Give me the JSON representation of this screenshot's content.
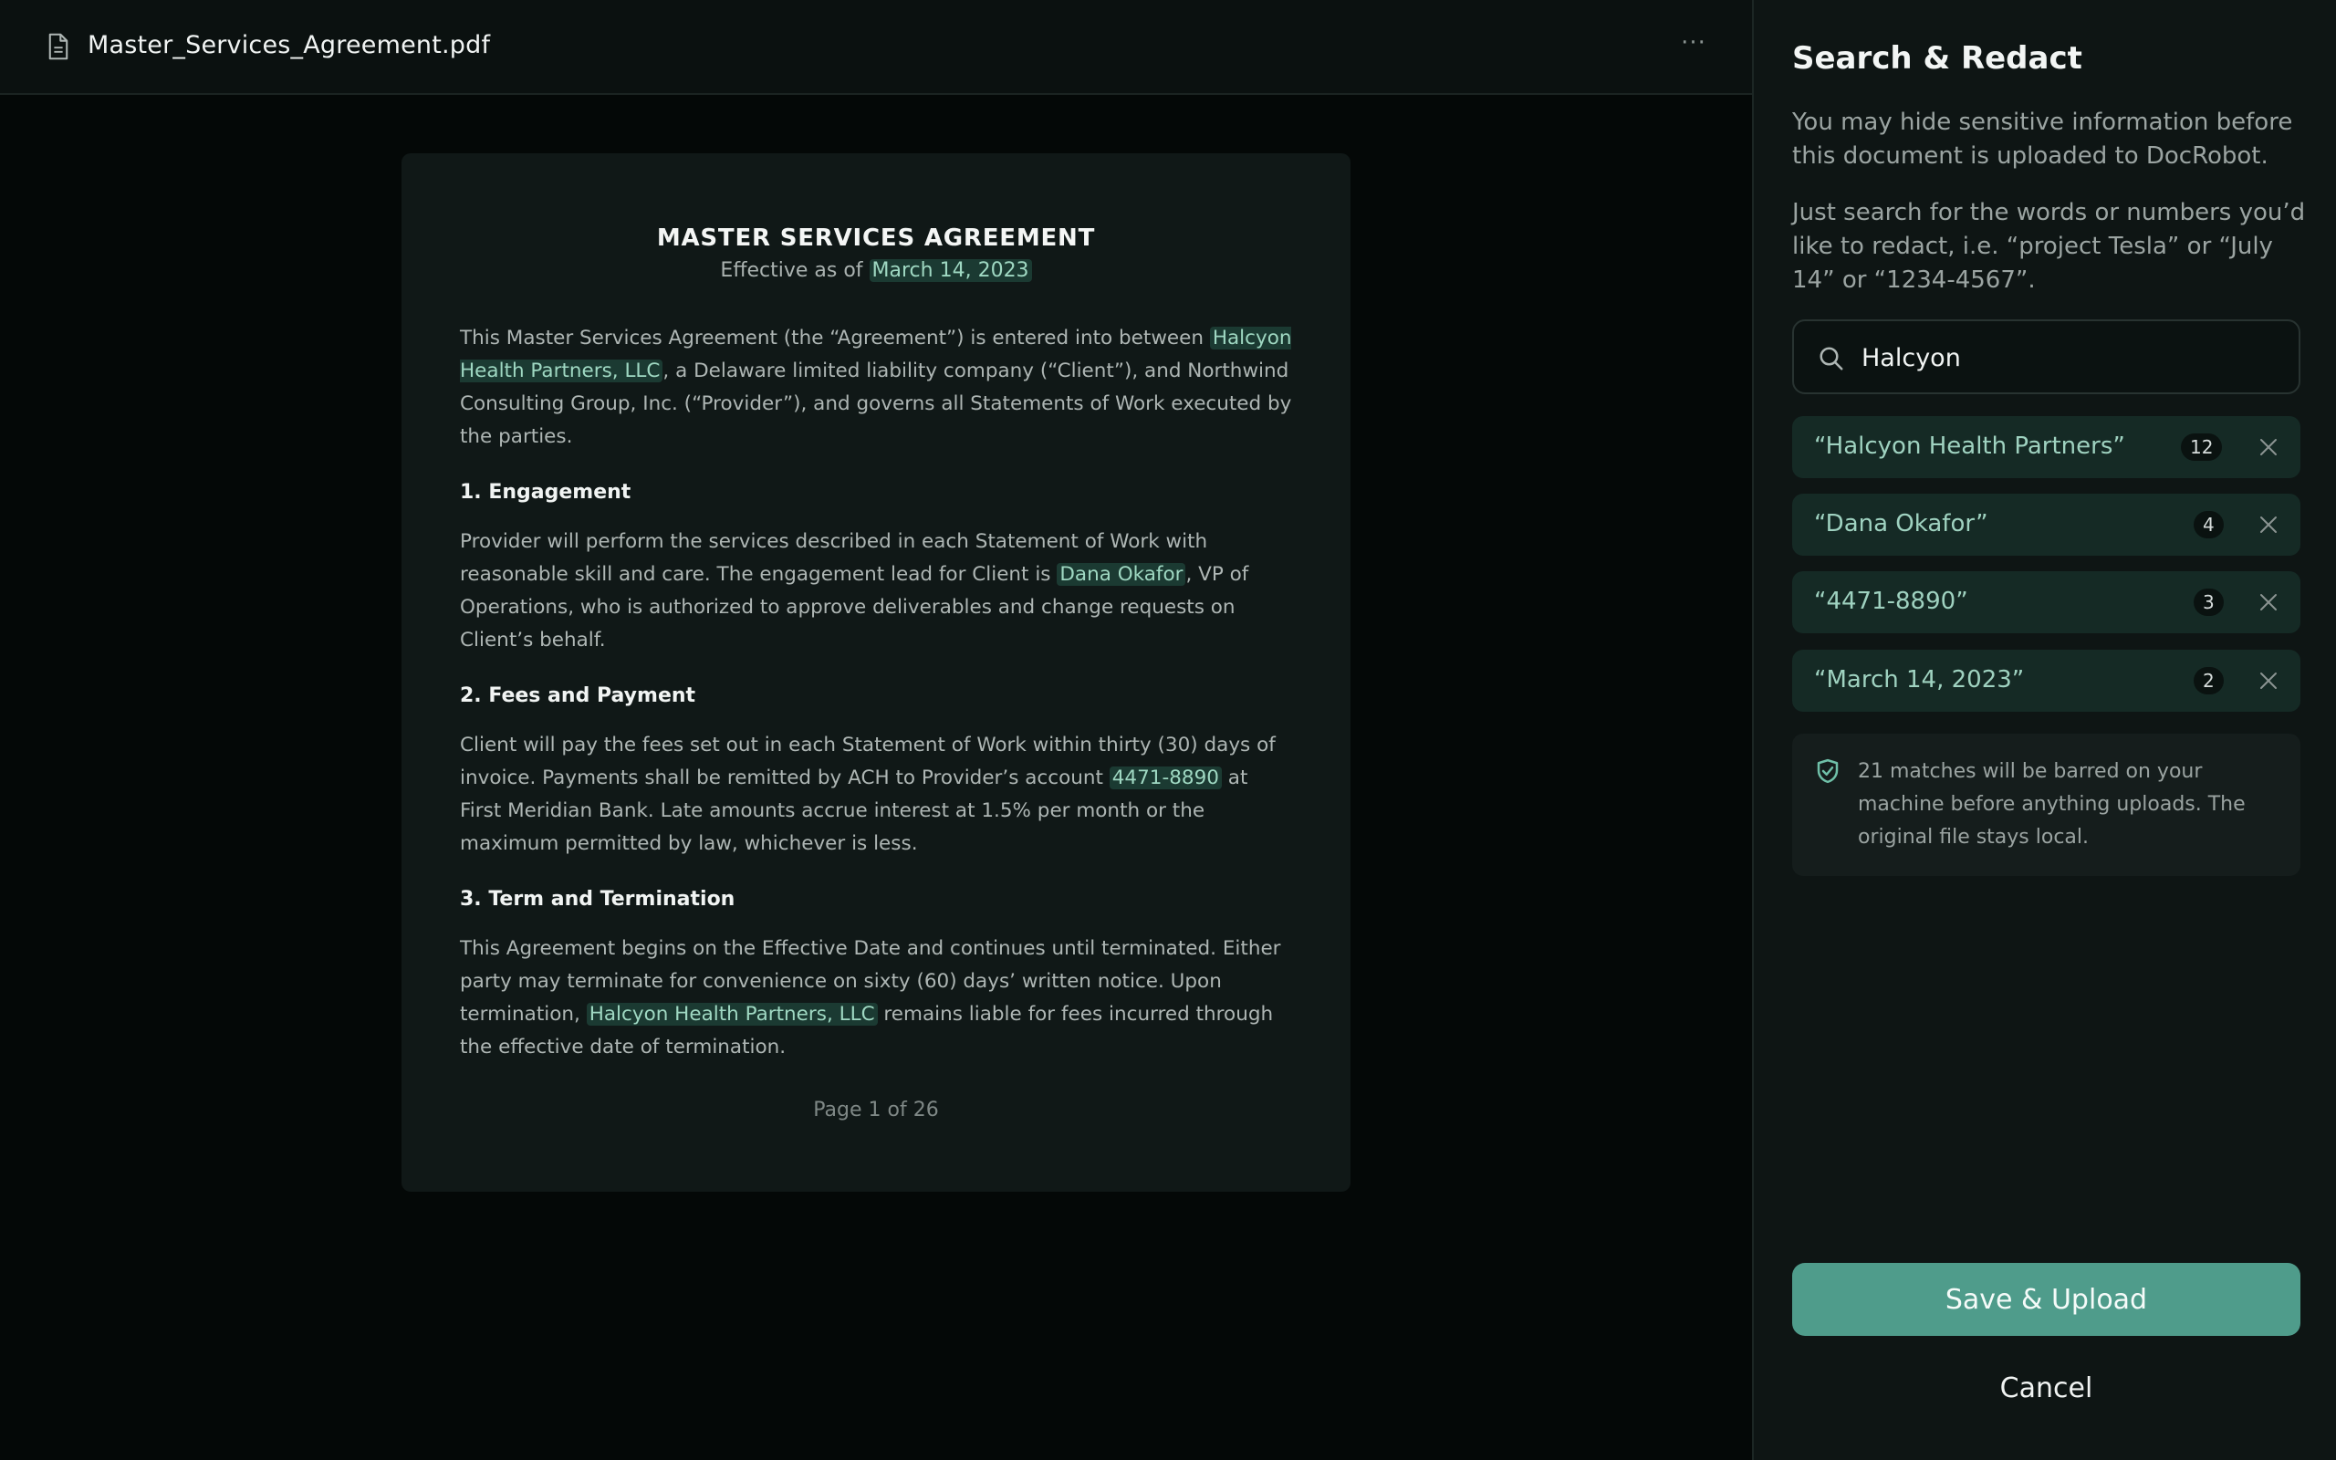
{
  "file": {
    "name": "Master_Services_Agreement.pdf",
    "icon": "document-icon",
    "more_label": "···"
  },
  "document": {
    "title": "MASTER SERVICES AGREEMENT",
    "effective_prefix": "Effective as of ",
    "effective_date": "March 14, 2023",
    "intro": {
      "t1": "This Master Services Agreement (the “Agreement”) is entered into between ",
      "h1": "Halcyon Health Partners, LLC",
      "t2": ", a Delaware limited liability company (“Client”), and Northwind Consulting Group, Inc. (“Provider”), and governs all Statements of Work executed by the parties."
    },
    "section1": {
      "heading": "1. Engagement",
      "t1": "Provider will perform the services described in each Statement of Work with reasonable skill and care. The engagement lead for Client is ",
      "h1": "Dana Okafor",
      "t2": ", VP of Operations, who is authorized to approve deliverables and change requests on Client’s behalf."
    },
    "section2": {
      "heading": "2. Fees and Payment",
      "t1": "Client will pay the fees set out in each Statement of Work within thirty (30) days of invoice. Payments shall be remitted by ACH to Provider’s account ",
      "h1": "4471-8890",
      "t2": " at First Meridian Bank. Late amounts accrue interest at 1.5% per month or the maximum permitted by law, whichever is less."
    },
    "section3": {
      "heading": "3. Term and Termination",
      "t1": "This Agreement begins on the Effective Date and continues until terminated. Either party may terminate for convenience on sixty (60) days’ written notice. Upon termination, ",
      "h1": "Halcyon Health Partners, LLC",
      "t2": " remains liable for fees incurred through the effective date of termination."
    },
    "page_indicator": "Page 1 of 26"
  },
  "panel": {
    "title": "Search & Redact",
    "description": "You may hide sensitive information before this document is uploaded to DocRobot.",
    "hint": "Just search for the words or numbers you’d like to redact, i.e. “project Tesla” or “July 14” or “1234-4567”.",
    "search": {
      "value": "Halcyon",
      "placeholder": ""
    },
    "terms": [
      {
        "label": "“Halcyon Health Partners”",
        "count": "12"
      },
      {
        "label": "“Dana Okafor”",
        "count": "4"
      },
      {
        "label": "“4471-8890”",
        "count": "3"
      },
      {
        "label": "“March 14, 2023”",
        "count": "2"
      }
    ],
    "notice": "21 matches will be barred on your machine before anything uploads. The original file stays local.",
    "save_label": "Save & Upload",
    "cancel_label": "Cancel"
  },
  "colors": {
    "accent": "#4f9c8b",
    "highlight_bg": "#1b3a32",
    "highlight_text": "#9fd8c2",
    "term_bg": "#152a25",
    "background": "#040807",
    "panel_bg": "#0e1514"
  }
}
